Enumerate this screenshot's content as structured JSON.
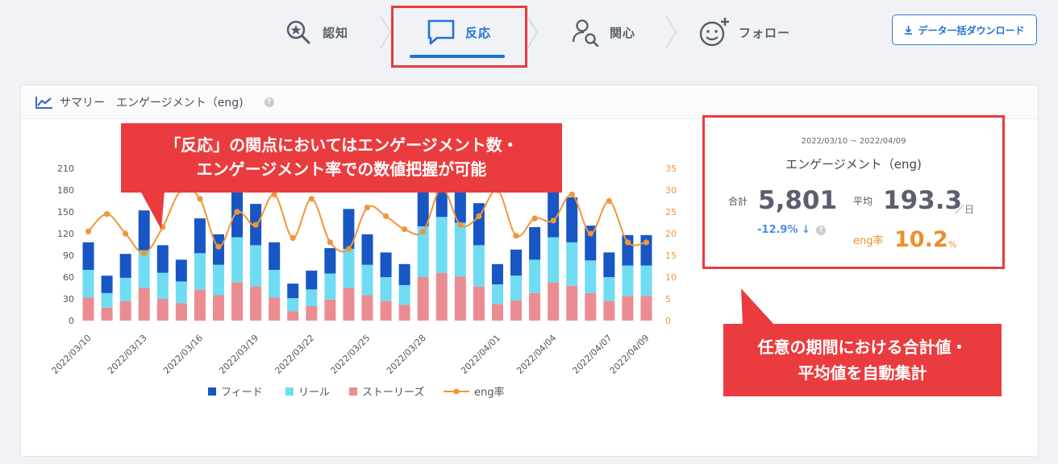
{
  "steps": [
    {
      "label": "認知",
      "icon": "magnify-star-icon"
    },
    {
      "label": "反応",
      "icon": "speech-bubble-icon"
    },
    {
      "label": "関心",
      "icon": "person-search-icon"
    },
    {
      "label": "フォロー",
      "icon": "smile-plus-icon"
    }
  ],
  "download_label": "データ一括ダウンロード",
  "panel": {
    "title": "サマリー　エンゲージメント（eng)",
    "help": "?"
  },
  "callout_top": {
    "line1": "「反応」の関点においてはエンゲージメント数・",
    "line2": "エンゲージメント率での数値把握が可能"
  },
  "callout_bottom": {
    "line1": "任意の期間における合計値・",
    "line2": "平均値を自動集計"
  },
  "summary": {
    "range": "2022/03/10 ~ 2022/04/09",
    "title": "エンゲージメント（eng)",
    "total_label": "合計",
    "total_value": "5,801",
    "change": "-12.9% ↓",
    "avg_label": "平均",
    "avg_value": "193.3",
    "avg_unit": "／日",
    "rate_label": "eng率",
    "rate_value": "10.2",
    "rate_unit": "%"
  },
  "legend": [
    "フィード",
    "リール",
    "ストーリーズ",
    "eng率"
  ],
  "colors": {
    "feed": "#1856c4",
    "reel": "#6fdcf3",
    "stories": "#ea8d92",
    "rate": "#f0963a",
    "accent": "#1f73d8",
    "callout": "#ea3c3f"
  },
  "chart_data": {
    "type": "bar",
    "stacked": true,
    "categories": [
      "2022/03/10",
      "2022/03/11",
      "2022/03/12",
      "2022/03/13",
      "2022/03/14",
      "2022/03/15",
      "2022/03/16",
      "2022/03/17",
      "2022/03/18",
      "2022/03/19",
      "2022/03/20",
      "2022/03/21",
      "2022/03/22",
      "2022/03/23",
      "2022/03/24",
      "2022/03/25",
      "2022/03/26",
      "2022/03/27",
      "2022/03/28",
      "2022/03/29",
      "2022/03/30",
      "2022/03/31",
      "2022/04/01",
      "2022/04/02",
      "2022/04/03",
      "2022/04/04",
      "2022/04/05",
      "2022/04/06",
      "2022/04/07",
      "2022/04/08",
      "2022/04/09"
    ],
    "x_tick_labels": [
      "2022/03/10",
      "2022/03/13",
      "2022/03/16",
      "2022/03/19",
      "2022/03/22",
      "2022/03/25",
      "2022/03/28",
      "2022/04/01",
      "2022/04/04",
      "2022/04/07",
      "2022/04/09"
    ],
    "series": [
      {
        "name": "ストーリーズ",
        "values": [
          32,
          18,
          27,
          45,
          30,
          24,
          43,
          35,
          53,
          47,
          32,
          13,
          20,
          29,
          45,
          35,
          27,
          22,
          60,
          66,
          61,
          47,
          23,
          28,
          38,
          53,
          48,
          38,
          27,
          34,
          34
        ]
      },
      {
        "name": "リール",
        "values": [
          38,
          20,
          32,
          52,
          36,
          30,
          50,
          42,
          62,
          57,
          38,
          18,
          23,
          36,
          54,
          42,
          33,
          27,
          70,
          77,
          74,
          57,
          27,
          34,
          46,
          62,
          60,
          45,
          33,
          42,
          42
        ]
      },
      {
        "name": "フィード",
        "values": [
          38,
          24,
          33,
          55,
          38,
          30,
          48,
          42,
          65,
          57,
          38,
          20,
          26,
          35,
          55,
          42,
          34,
          29,
          75,
          85,
          82,
          58,
          28,
          36,
          45,
          70,
          62,
          48,
          34,
          42,
          42
        ]
      },
      {
        "name": "eng率",
        "axis": "right",
        "values": [
          20.5,
          24.5,
          20,
          15.5,
          21.5,
          30,
          28,
          17,
          25,
          22,
          29,
          19,
          28,
          18,
          16.5,
          26,
          24,
          21,
          20.5,
          30.5,
          22,
          24,
          30,
          19.5,
          23.5,
          23,
          29,
          20,
          27.5,
          18,
          18
        ]
      }
    ],
    "y_left": {
      "ticks": [
        0,
        30,
        60,
        90,
        120,
        150,
        180,
        210
      ],
      "ylim": [
        0,
        210
      ]
    },
    "y_right": {
      "ticks": [
        0,
        5,
        10,
        15,
        20,
        25,
        30,
        35
      ],
      "ylim": [
        0,
        35
      ]
    }
  }
}
